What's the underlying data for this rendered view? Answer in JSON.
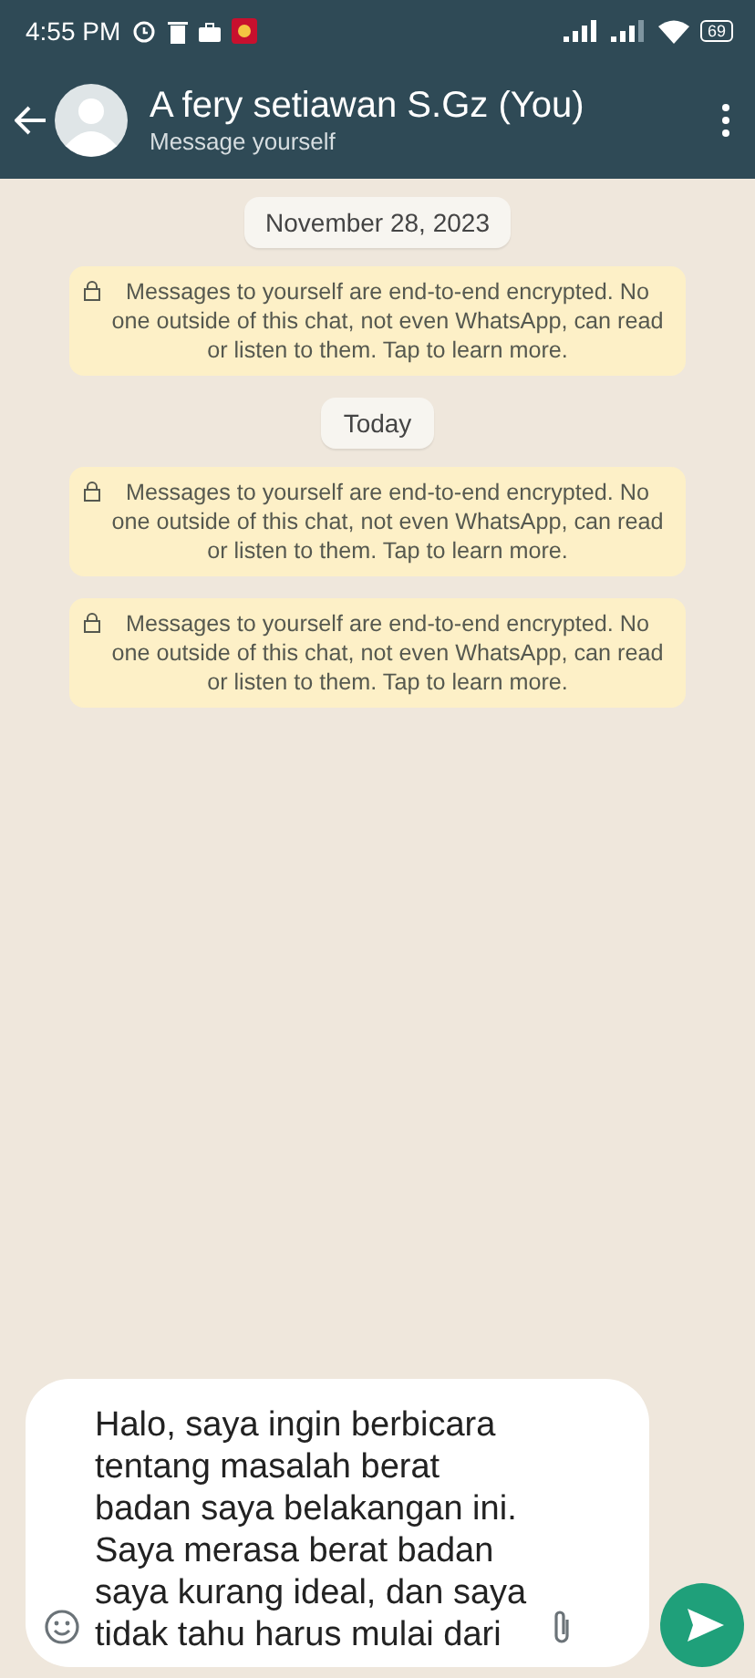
{
  "status_bar": {
    "time": "4:55 PM",
    "battery": "69"
  },
  "header": {
    "title": "A fery setiawan S.Gz (You)",
    "subtitle": "Message yourself"
  },
  "chat": [
    {
      "kind": "date",
      "text": "November 28, 2023"
    },
    {
      "kind": "notice",
      "text": "Messages to yourself are end-to-end encrypted. No one outside of this chat, not even WhatsApp, can read or listen to them. Tap to learn more."
    },
    {
      "kind": "date",
      "text": "Today"
    },
    {
      "kind": "notice",
      "text": "Messages to yourself are end-to-end encrypted. No one outside of this chat, not even WhatsApp, can read or listen to them. Tap to learn more."
    },
    {
      "kind": "notice",
      "text": "Messages to yourself are end-to-end encrypted. No one outside of this chat, not even WhatsApp, can read or listen to them. Tap to learn more."
    }
  ],
  "composer": {
    "value": "Halo, saya ingin berbicara tentang masalah berat badan saya belakangan ini. Saya merasa berat badan saya kurang ideal, dan saya tidak tahu harus mulai dari"
  }
}
